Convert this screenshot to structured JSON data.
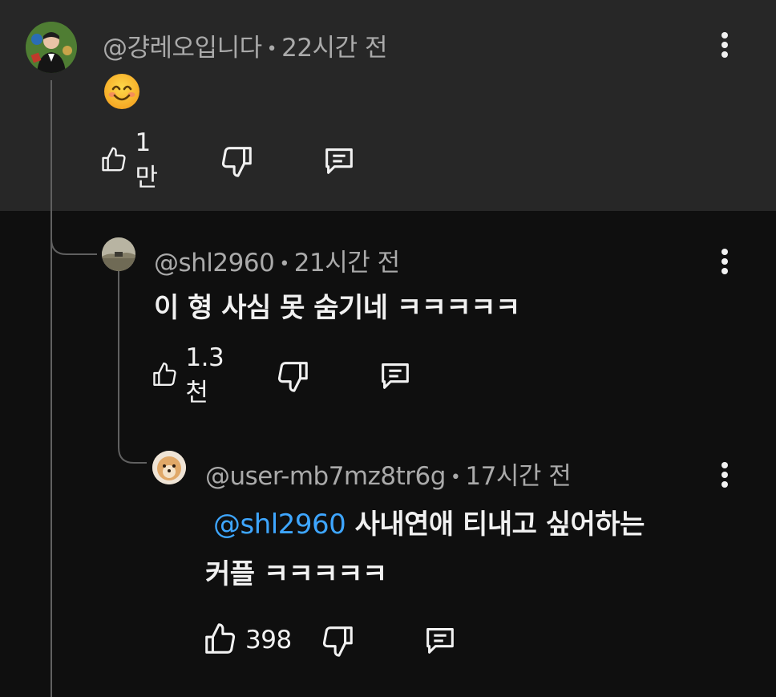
{
  "comments": [
    {
      "author": "@걍레오입니다",
      "time": "22시간 전",
      "text": "",
      "likes": "1만",
      "emoji": "smiling-face-emoji"
    },
    {
      "author": "@shl2960",
      "time": "21시간 전",
      "text": "이 형 사심 못 숨기네 ㅋㅋㅋㅋㅋ",
      "likes": "1.3천"
    },
    {
      "author": "@user-mb7mz8tr6g",
      "time": "17시간 전",
      "mention": "@shl2960",
      "text_line1": "사내연애 티내고 싶어하는",
      "text_line2": "커플 ㅋㅋㅋㅋㅋ",
      "likes": "398"
    }
  ],
  "separator": "•",
  "colors": {
    "background": "#0f0f0f",
    "highlighted_background": "#272727",
    "mention": "#3ea6ff",
    "meta": "#aaaaaa",
    "thread_line": "#606060"
  }
}
